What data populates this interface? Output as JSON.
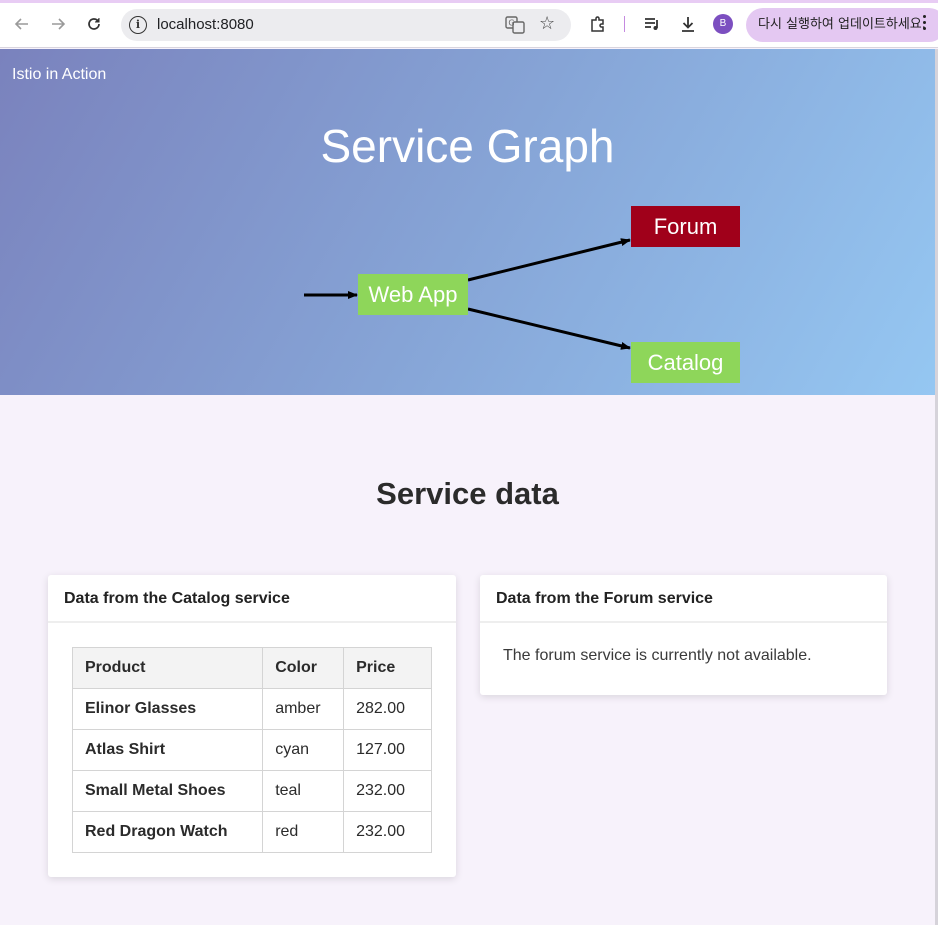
{
  "browser": {
    "url": "localhost:8080",
    "profile_initial": "B",
    "update_label": "다시 실행하여 업데이트하세요."
  },
  "hero": {
    "brand": "Istio in Action",
    "title": "Service Graph",
    "nodes": {
      "webapp": "Web App",
      "forum": "Forum",
      "catalog": "Catalog"
    },
    "colors": {
      "webapp": "#8ed65a",
      "forum": "#a0001a",
      "catalog": "#8ed65a"
    }
  },
  "main": {
    "section_title": "Service data",
    "catalog_card": {
      "title": "Data from the Catalog service",
      "columns": [
        "Product",
        "Color",
        "Price"
      ],
      "rows": [
        [
          "Elinor Glasses",
          "amber",
          "282.00"
        ],
        [
          "Atlas Shirt",
          "cyan",
          "127.00"
        ],
        [
          "Small Metal Shoes",
          "teal",
          "232.00"
        ],
        [
          "Red Dragon Watch",
          "red",
          "232.00"
        ]
      ]
    },
    "forum_card": {
      "title": "Data from the Forum service",
      "message": "The forum service is currently not available."
    }
  }
}
